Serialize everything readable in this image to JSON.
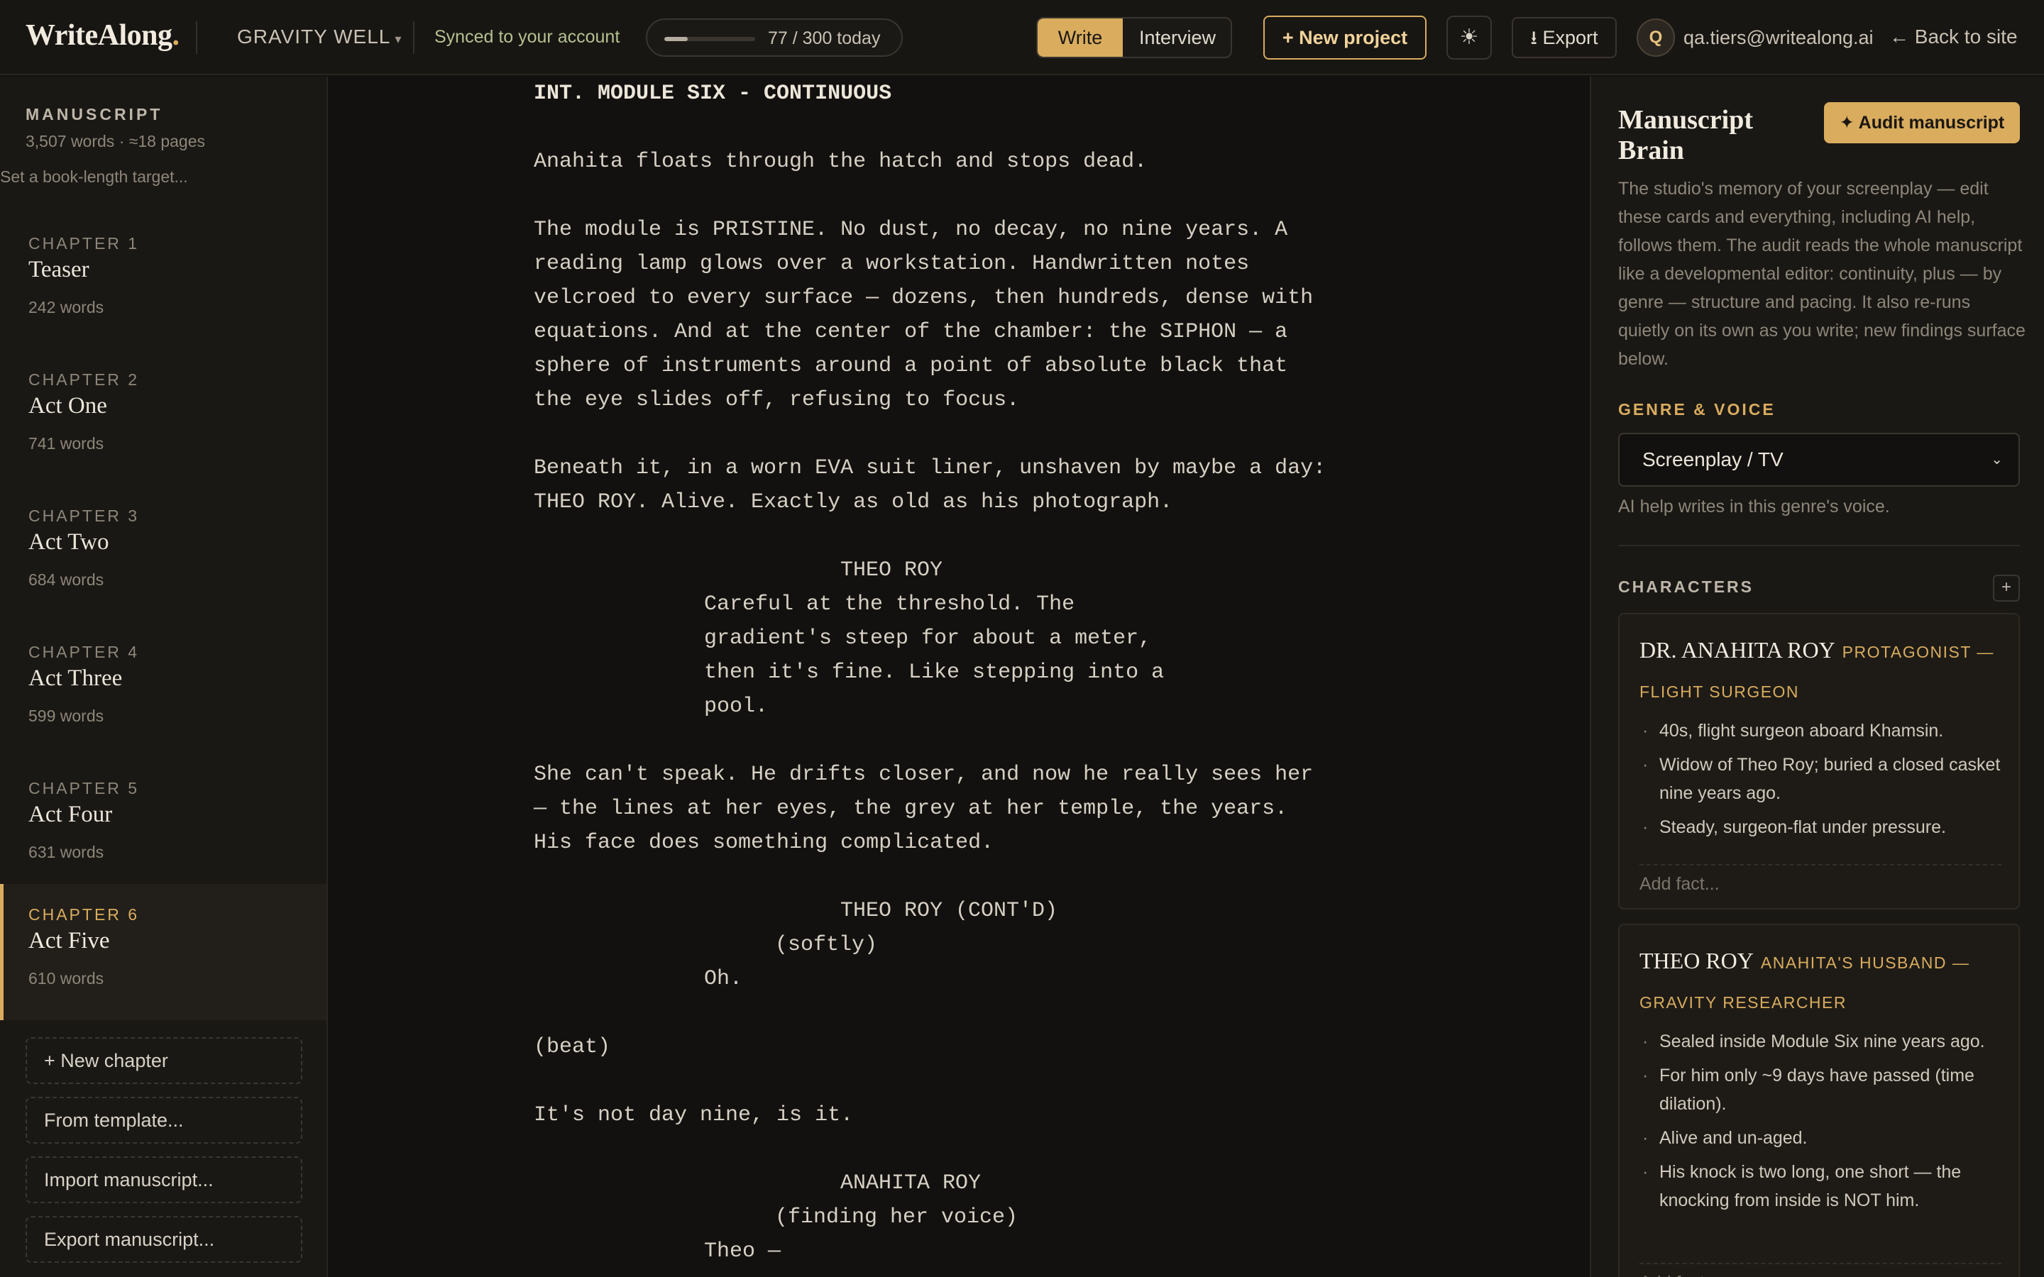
{
  "header": {
    "logo": "WriteAlong",
    "logo_dot": ".",
    "project": "GRAVITY WELL",
    "project_caret": "▾",
    "sync_status": "Synced to your account",
    "progress": {
      "label": "77 / 300 today",
      "current": 77,
      "goal": 300
    },
    "modes": {
      "write": "Write",
      "interview": "Interview",
      "active": "write"
    },
    "new_project": "+ New project",
    "theme_icon": "☀",
    "export": "⭳ Export",
    "avatar_initial": "Q",
    "email": "qa.tiers@writealong.ai",
    "back": "← Back to site"
  },
  "sidebar": {
    "title": "MANUSCRIPT",
    "meta": "3,507 words · ≈18 pages",
    "target_placeholder": "Set a book-length target...",
    "chapters": [
      {
        "num": "CHAPTER 1",
        "title": "Teaser",
        "words": "242 words"
      },
      {
        "num": "CHAPTER 2",
        "title": "Act One",
        "words": "741 words"
      },
      {
        "num": "CHAPTER 3",
        "title": "Act Two",
        "words": "684 words"
      },
      {
        "num": "CHAPTER 4",
        "title": "Act Three",
        "words": "599 words"
      },
      {
        "num": "CHAPTER 5",
        "title": "Act Four",
        "words": "631 words"
      },
      {
        "num": "CHAPTER 6",
        "title": "Act Five",
        "words": "610 words"
      }
    ],
    "active_chapter": 6,
    "buttons": {
      "new_chapter": "+ New chapter",
      "from_template": "From template...",
      "import": "Import manuscript...",
      "export": "Export manuscript..."
    }
  },
  "editor": {
    "lines": [
      "INT. MODULE SIX - CONTINUOUS",
      "Anahita floats through the hatch and stops dead.",
      "The module is PRISTINE. No dust, no decay, no nine years. A",
      "reading lamp glows over a workstation. Handwritten notes",
      "velcroed to every surface — dozens, then hundreds, dense with",
      "equations. And at the center of the chamber: the SIPHON — a",
      "sphere of instruments around a point of absolute black that",
      "the eye slides off, refusing to focus.",
      "Beneath it, in a worn EVA suit liner, unshaven by maybe a day:",
      "THEO ROY. Alive. Exactly as old as his photograph.",
      "THEO ROY",
      "Careful at the threshold. The",
      "gradient's steep for about a meter,",
      "then it's fine. Like stepping into a",
      "pool.",
      "She can't speak. He drifts closer, and now he really sees her",
      "— the lines at her eyes, the grey at her temple, the years.",
      "His face does something complicated.",
      "THEO ROY (CONT'D)",
      "(softly)",
      "Oh.",
      "(beat)",
      "It's not day nine, is it.",
      "ANAHITA ROY",
      "(finding her voice)",
      "Theo —"
    ]
  },
  "brain": {
    "title": "Manuscript Brain",
    "audit_button": "✦ Audit manuscript",
    "description": "The studio's memory of your screenplay — edit these cards and everything, including AI help, follows them. The audit reads the whole manuscript like a developmental editor: continuity, plus — by genre — structure and pacing. It also re-runs quietly on its own as you write; new findings surface below.",
    "genre_label": "GENRE & VOICE",
    "genre_value": "Screenplay / TV",
    "genre_chevron": "⌄",
    "genre_hint": "AI help writes in this genre's voice.",
    "characters_label": "CHARACTERS",
    "add_character": "+",
    "characters": [
      {
        "name": "DR. ANAHITA ROY",
        "role": "PROTAGONIST — FLIGHT SURGEON",
        "facts": [
          "40s, flight surgeon aboard Khamsin.",
          "Widow of Theo Roy; buried a closed casket nine years ago.",
          "Steady, surgeon-flat under pressure."
        ],
        "add_fact": "Add fact..."
      },
      {
        "name": "THEO ROY",
        "role": "ANAHITA'S HUSBAND — GRAVITY RESEARCHER",
        "facts": [
          "Sealed inside Module Six nine years ago.",
          "For him only ~9 days have passed (time dilation).",
          "Alive and un-aged.",
          "His knock is two long, one short — the knocking from inside is NOT him."
        ],
        "add_fact": "Add fact..."
      }
    ]
  }
}
